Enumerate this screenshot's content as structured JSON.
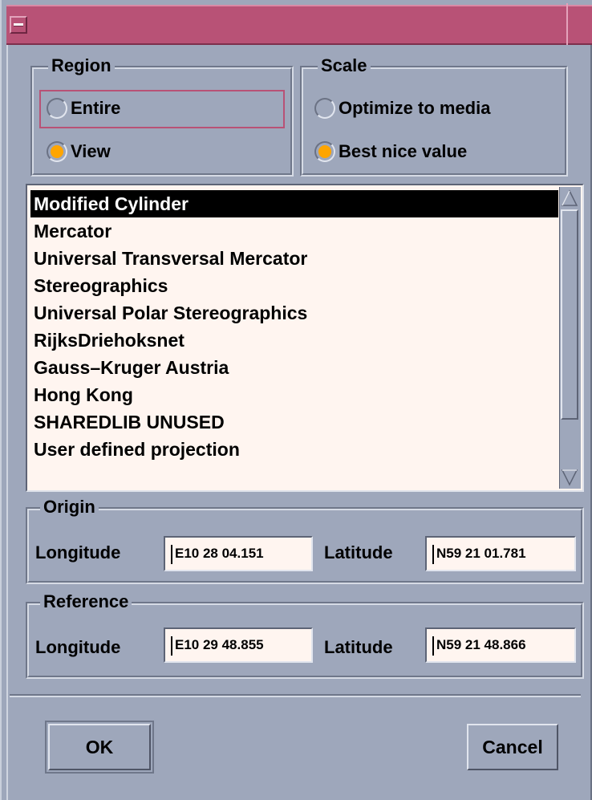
{
  "region": {
    "title": "Region",
    "options": [
      {
        "label": "Entire",
        "selected": false
      },
      {
        "label": "View",
        "selected": true
      }
    ]
  },
  "scale": {
    "title": "Scale",
    "options": [
      {
        "label": "Optimize to media",
        "selected": false
      },
      {
        "label": "Best nice value",
        "selected": true
      }
    ]
  },
  "projections": {
    "items": [
      "Modified Cylinder",
      "Mercator",
      "Universal Transversal Mercator",
      "Stereographics",
      "Universal Polar Stereographics",
      "RijksDriehoksnet",
      "Gauss–Kruger Austria",
      "Hong Kong",
      "SHAREDLIB UNUSED",
      "User defined projection"
    ],
    "selected_index": 0
  },
  "origin": {
    "title": "Origin",
    "longitude_label": "Longitude",
    "longitude_value": "E10 28 04.151",
    "latitude_label": "Latitude",
    "latitude_value": "N59 21 01.781"
  },
  "reference": {
    "title": "Reference",
    "longitude_label": "Longitude",
    "longitude_value": "E10 29 48.855",
    "latitude_label": "Latitude",
    "latitude_value": "N59 21 48.866"
  },
  "buttons": {
    "ok": "OK",
    "cancel": "Cancel"
  },
  "colors": {
    "titlebar": "#b85276",
    "dialog_bg": "#9ea7bb",
    "field_bg": "#fff5f0",
    "radio_on": "#ffa500"
  }
}
